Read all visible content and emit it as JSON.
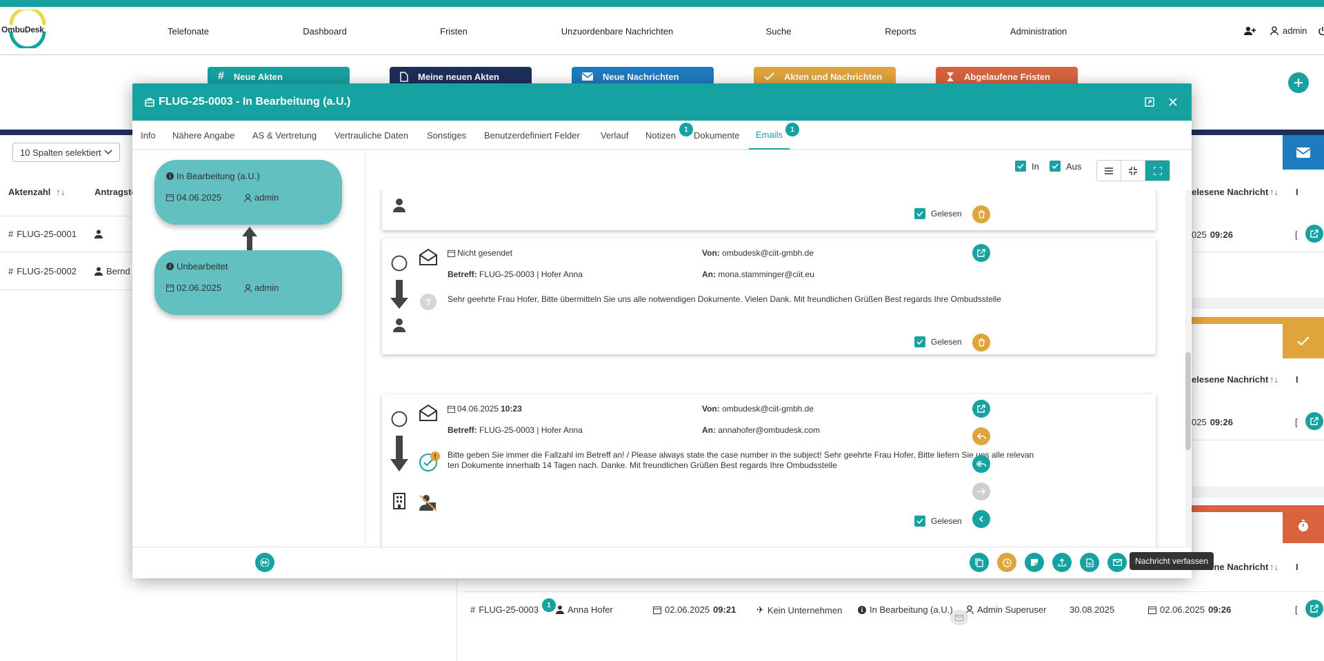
{
  "app": {
    "logo_text": "OmbuDesk",
    "user": "admin"
  },
  "nav": [
    "Telefonate",
    "Dashboard",
    "Fristen",
    "Unzuordenbare Nachrichten",
    "Suche",
    "Reports",
    "Administration"
  ],
  "summary_cards": [
    {
      "label": "Neue Akten",
      "color": "#17a2a2",
      "icon": "hash-icon"
    },
    {
      "label": "Meine neuen Akten",
      "color": "#1d2e5b",
      "icon": "file-icon"
    },
    {
      "label": "Neue Nachrichten",
      "color": "#1e7bbf",
      "icon": "envelope-icon"
    },
    {
      "label": "Akten und Nachrichten",
      "color": "#e0a43c",
      "icon": "check-icon"
    },
    {
      "label": "Abgelaufene Fristen",
      "color": "#d9633f",
      "icon": "hourglass-icon"
    }
  ],
  "background": {
    "column_select": "10 Spalten selektiert",
    "headers": {
      "aktenzahl": "Aktenzahl",
      "antragsteller": "Antragste",
      "gelesene": "elesene Nachricht",
      "i": "I"
    },
    "rows": [
      {
        "aktenzahl": "FLUG-25-0001",
        "antragsteller": "",
        "date_prefix": "025",
        "time": "09:26"
      },
      {
        "aktenzahl": "FLUG-25-0002",
        "antragsteller": "Bernd I",
        "date_prefix": "",
        "time": ""
      }
    ],
    "section2": {
      "header": "elesene Nachricht",
      "date_prefix": "025",
      "time": "09:26"
    },
    "section3": {
      "header": "elesene Nachricht"
    },
    "bottom_row": {
      "aktenzahl": "FLUG-25-0003",
      "badge": "1",
      "name": "Anna Hofer",
      "date": "02.06.2025",
      "time": "09:21",
      "company": "Kein Unternehmen",
      "status": "In Bearbeitung (a.U.)",
      "user": "Admin Superuser",
      "deadline": "30.08.2025",
      "last_date": "02.06.2025",
      "last_time": "09:26"
    }
  },
  "modal": {
    "title": "FLUG-25-0003 - In Bearbeitung (a.U.)",
    "tabs": [
      {
        "label": "Info"
      },
      {
        "label": "Nähere Angabe"
      },
      {
        "label": "AS & Vertretung"
      },
      {
        "label": "Vertrauliche Daten"
      },
      {
        "label": "Sonstiges"
      },
      {
        "label": "Benutzerdefiniert Felder"
      },
      {
        "label": "Verlauf"
      },
      {
        "label": "Notizen",
        "badge": "1"
      },
      {
        "label": "Dokumente"
      },
      {
        "label": "Emails",
        "badge": "1",
        "active": true
      }
    ],
    "status_history": [
      {
        "status": "In Bearbeitung (a.U.)",
        "date": "04.06.2025",
        "user": "admin"
      },
      {
        "status": "Unbearbeitet",
        "date": "02.06.2025",
        "user": "admin"
      }
    ],
    "filters": {
      "in_label": "In",
      "out_label": "Aus",
      "in_checked": true,
      "out_checked": true
    },
    "emails": [
      {
        "read_label": "Gelesen"
      },
      {
        "date_label": "Nicht gesendet",
        "time": "",
        "from_label": "Von:",
        "from": "ombudesk@ciit-gmbh.de",
        "subject_label": "Betreff:",
        "subject": "FLUG-25-0003 | Hofer Anna",
        "to_label": "An:",
        "to": "mona.stamminger@ciit.eu",
        "body": "Sehr geehrte Frau Hofer, Bitte übermitteln Sie uns alle notwendigen Dokumente. Vielen Dank.  Mit freundlichen Grüßen Best regards Ihre Ombudsstelle",
        "read_label": "Gelesen"
      },
      {
        "date_label": "04.06.2025",
        "time": "10:23",
        "from_label": "Von:",
        "from": "ombudesk@ciit-gmbh.de",
        "subject_label": "Betreff:",
        "subject": "FLUG-25-0003 | Hofer Anna",
        "to_label": "An:",
        "to": "annahofer@ombudesk.com",
        "body_line1": "Bitte geben Sie immer die Fallzahl im Betreff an! / Please always state the case number in the subject! Sehr geehrte Frau Hofer, Bitte liefern Sie uns alle relevan",
        "body_line2": "ten Dokumente innerhalb 14 Tagen nach. Danke. Mit freundlichen Grüßen Best regards Ihre Ombudsstelle",
        "read_label": "Gelesen"
      }
    ],
    "tooltip": "Nachricht verfassen"
  }
}
